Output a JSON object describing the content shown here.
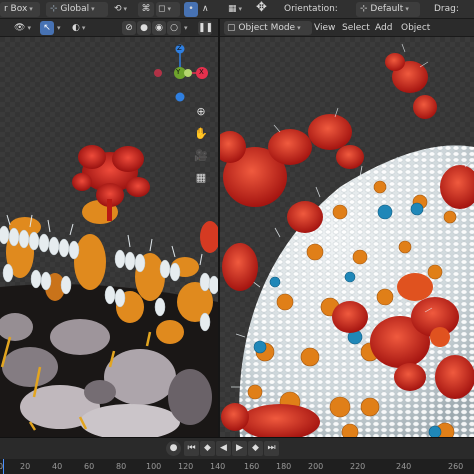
{
  "left_header": {
    "box_label": "r Box",
    "transform_label": "Global",
    "snap_icon": "snap-icon",
    "proportional_icon": "proportional-icon"
  },
  "right_header": {
    "transform_icon": "move-gizmo-icon",
    "orientation_label": "Orientation:",
    "orientation_value": "Default",
    "drag_label": "Drag:"
  },
  "left_toolbar": {
    "icons": [
      "eye-icon",
      "select-icon",
      "overlay-icon",
      "wireframe-icon",
      "solid-icon",
      "material-icon",
      "rendered-icon",
      "pause-icon"
    ]
  },
  "right_toolbar": {
    "mode_label": "Object Mode",
    "menu": [
      "View",
      "Select",
      "Add",
      "Object"
    ]
  },
  "navigation_gizmo": {
    "axes": [
      "Y",
      "X",
      "Z"
    ],
    "colors": {
      "x": "#e5304d",
      "y": "#6ea32c",
      "z": "#2f7fe0"
    }
  },
  "viewport_tools": [
    "zoom-icon",
    "hand-icon",
    "camera-icon",
    "grid-icon"
  ],
  "timeline": {
    "ticks": [
      "0",
      "20",
      "40",
      "60",
      "80",
      "100",
      "120",
      "140",
      "160",
      "180",
      "200",
      "220",
      "240",
      "260"
    ],
    "playback_icons": [
      "record-icon",
      "jump-start-icon",
      "prev-key-icon",
      "play-reverse-icon",
      "play-icon",
      "next-key-icon",
      "jump-end-icon"
    ]
  },
  "colors": {
    "header_bg": "#303030",
    "accent": "#4772b3",
    "spike_red": "#c8201a",
    "lipid_orange": "#e08a1e",
    "lipid_white": "#e8eef0",
    "protein_blue": "#1f87b8"
  }
}
